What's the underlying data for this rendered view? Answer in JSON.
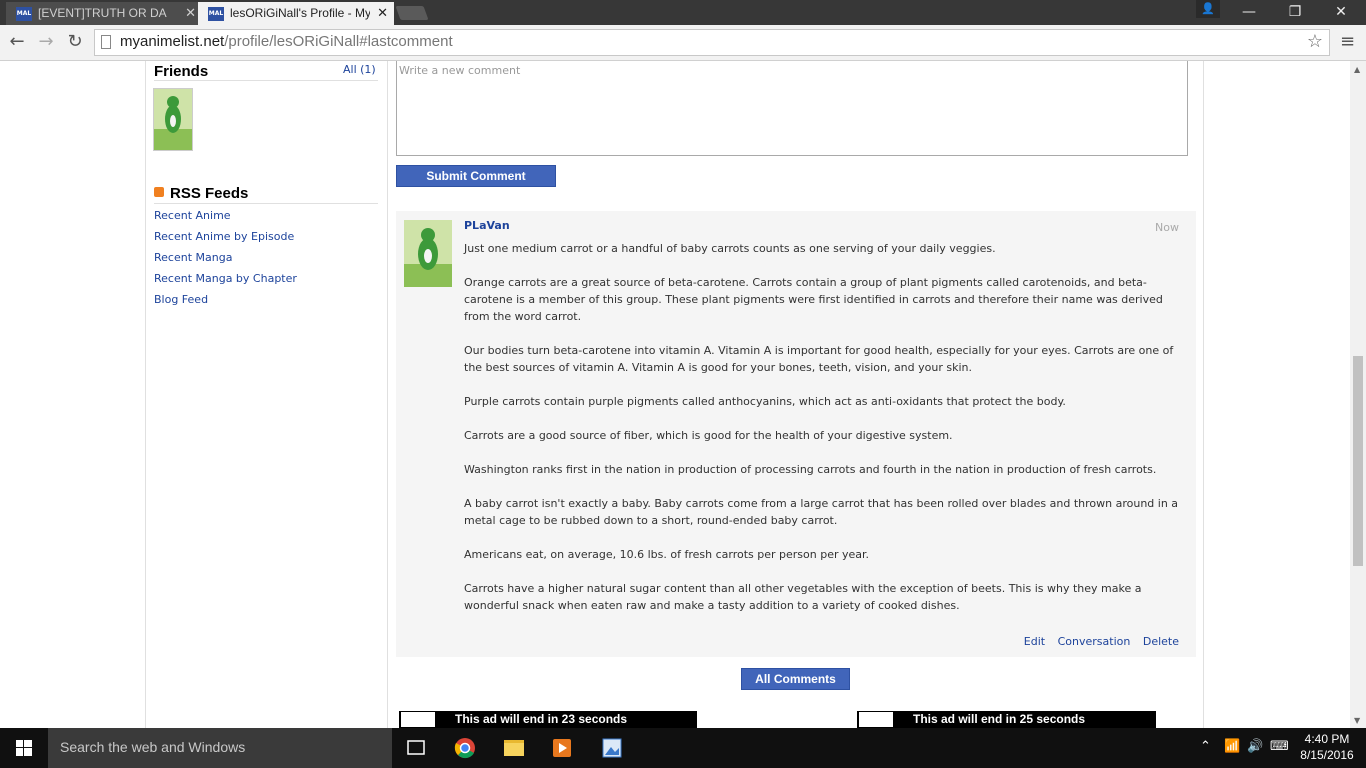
{
  "browser": {
    "tabs": [
      {
        "favicon": "MAL",
        "title": "[EVENT]TRUTH OR DA"
      },
      {
        "favicon": "MAL",
        "title": "lesORiGiNall's Profile - My"
      }
    ],
    "close_glyph": "✕",
    "window_controls": {
      "minimize": "—",
      "restore": "❐",
      "close": "✕"
    },
    "url_domain": "myanimelist.net",
    "url_path": "/profile/lesORiGiNall#lastcomment",
    "back_glyph": "←",
    "forward_glyph": "→",
    "reload_glyph": "↻",
    "star_glyph": "☆",
    "menu_glyph": "≡",
    "account_glyph": "👤"
  },
  "sidebar": {
    "friends_title": "Friends",
    "friends_all": "All (1)",
    "rss_title": "RSS Feeds",
    "rss_links": [
      "Recent Anime",
      "Recent Anime by Episode",
      "Recent Manga",
      "Recent Manga by Chapter",
      "Blog Feed"
    ]
  },
  "comment_form": {
    "placeholder": "Write a new comment",
    "submit_label": "Submit Comment"
  },
  "comment": {
    "username": "PLaVan",
    "time": "Now",
    "paragraphs": [
      "Just one medium carrot or a handful of baby carrots counts as one serving of your daily veggies.",
      "Orange carrots are a great source of beta-carotene. Carrots contain a group of plant pigments called carotenoids, and beta-carotene is a member of this group. These plant pigments were first identified in carrots and therefore their name was derived from the word carrot.",
      "Our bodies turn beta-carotene into vitamin A. Vitamin A is important for good health, especially for your eyes. Carrots are one of the best sources of vitamin A. Vitamin A is good for your bones, teeth, vision, and your skin.",
      "Purple carrots contain purple pigments called anthocyanins, which act as anti-oxidants that protect the body.",
      "Carrots are a good source of fiber, which is good for the health of your digestive system.",
      "Washington ranks first in the nation in production of processing carrots and fourth in the nation in production of fresh carrots.",
      "A baby carrot isn't exactly a baby. Baby carrots come from a large carrot that has been rolled over blades and thrown around in a metal cage to be rubbed down to a short, round-ended baby carrot.",
      "Americans eat, on average, 10.6 lbs. of fresh carrots per person per year.",
      "Carrots have a higher natural sugar content than all other vegetables with the exception of beets. This is why they make a wonderful snack when eaten raw and make a tasty addition to a variety of cooked dishes."
    ],
    "actions": {
      "edit": "Edit",
      "conversation": "Conversation",
      "delete": "Delete"
    }
  },
  "all_comments_label": "All Comments",
  "ads": [
    {
      "text": "This ad will end in 23 seconds"
    },
    {
      "text": "This ad will end in 25 seconds"
    }
  ],
  "taskbar": {
    "search_placeholder": "Search the web and Windows",
    "time": "4:40 PM",
    "date": "8/15/2016"
  },
  "colors": {
    "link": "#1d439b",
    "button": "#4165ba",
    "comment_bg": "#f5f5f5"
  }
}
